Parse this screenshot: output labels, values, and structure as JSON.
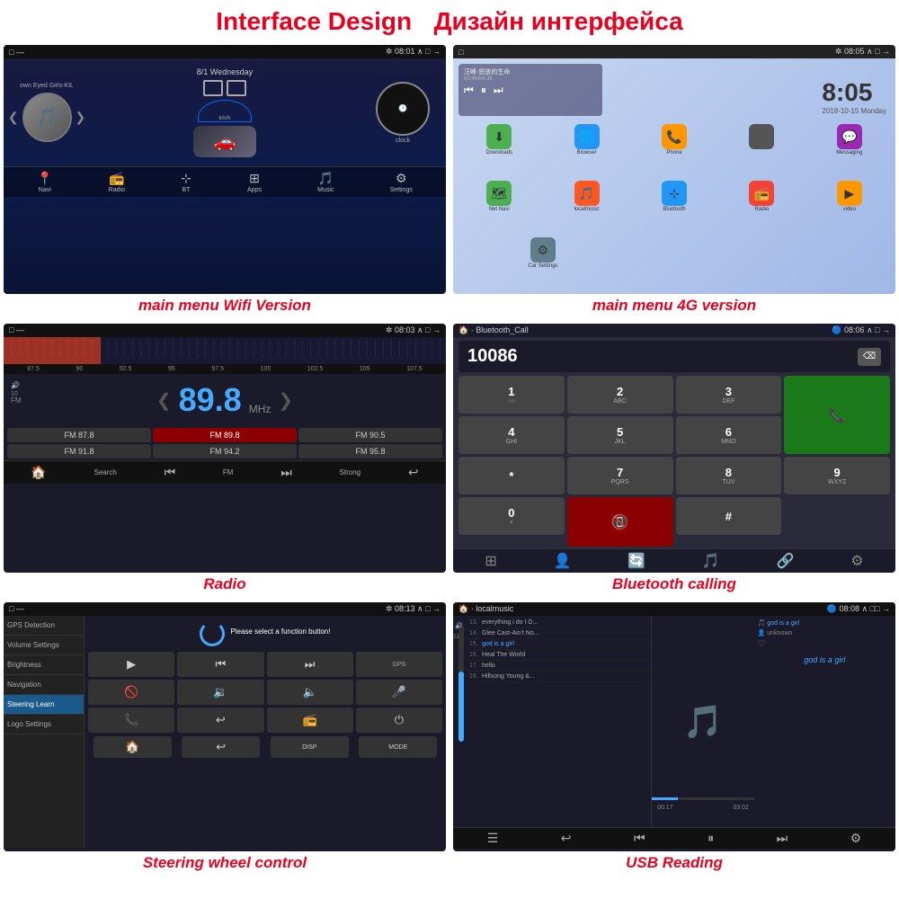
{
  "header": {
    "title_en": "Interface Design",
    "title_ru": "Дизайн интерфейса"
  },
  "captions": {
    "wifi": "main menu Wifi Version",
    "g4": "main menu 4G version",
    "radio": "Radio",
    "bluetooth": "Bluetooth calling",
    "steering": "Steering wheel control",
    "usb": "USB Reading"
  },
  "screen1": {
    "topbar_time": "08:01",
    "song": "own Eyed Girls-KIL",
    "date": "8/1 Wednesday",
    "kmh": "km/h",
    "clock_label": "clock",
    "nav_items": [
      "Navi",
      "Radio",
      "BT",
      "Apps",
      "Music",
      "Settings"
    ]
  },
  "screen2": {
    "topbar_time": "08:05",
    "player_title": "汪峰·怒放的生命",
    "player_time": "00:46/04:35",
    "time_big": "8:05",
    "date_text": "2018-10-15  Monday",
    "apps": [
      {
        "name": "Downloads",
        "color": "#4caf50"
      },
      {
        "name": "Browser",
        "color": "#2196f3"
      },
      {
        "name": "Phone",
        "color": "#ff9800"
      },
      {
        "name": "",
        "color": "#9e9e9e"
      },
      {
        "name": "Messaging",
        "color": "#9c27b0"
      },
      {
        "name": "Net Navi",
        "color": "#4caf50"
      },
      {
        "name": "localmusic",
        "color": "#ff5722"
      },
      {
        "name": "Bluetooth",
        "color": "#2196f3"
      },
      {
        "name": "Radio",
        "color": "#f44336"
      },
      {
        "name": "video",
        "color": "#ff9800"
      },
      {
        "name": "Car Settings",
        "color": "#607d8b"
      }
    ]
  },
  "screen3": {
    "topbar_time": "08:03",
    "freq_scale": [
      "87.5",
      "90",
      "92.5",
      "95",
      "97.5",
      "100",
      "102.5",
      "105",
      "107.5"
    ],
    "current_freq": "89.8",
    "mhz": "MHz",
    "fm_label": "FM",
    "presets": [
      "FM 87.8",
      "FM 89.8",
      "FM 90.5",
      "FM 91.8",
      "FM 94.2",
      "FM 95.8"
    ],
    "active_preset": "FM 89.8",
    "bottom_items": [
      "🏠",
      "Search",
      "⏮",
      "FM",
      "⏭",
      "Strong",
      "↩"
    ]
  },
  "screen4": {
    "topbar_label": "Bluetooth_Call",
    "topbar_time": "08:06",
    "number": "10086",
    "keys": [
      "1",
      "2 ABC",
      "3 DEF",
      "*",
      "4 GHI",
      "5 JKL",
      "6 MNO",
      "0 +",
      "7 PQRS",
      "8 TUV",
      "9 WXYZ",
      "#"
    ],
    "bottom_icons": [
      "⊞",
      "👤",
      "🔄",
      "🎵",
      "🔗",
      "⚙"
    ]
  },
  "screen5": {
    "topbar_time": "08:13",
    "instruction": "Please select a function button!",
    "sidebar_items": [
      "GPS Detection",
      "Volume Settings",
      "Brightness",
      "Navigation",
      "Steering Learn",
      "Logo Settings"
    ],
    "active_item": "Steering Learn",
    "btn_rows": [
      [
        "▶",
        "⏮",
        "⏭",
        "GPS"
      ],
      [
        "🚫",
        "🔉",
        "🔈",
        "🎤"
      ],
      [
        "📞",
        "↩",
        "📻",
        "⏻"
      ]
    ],
    "bottom_row": [
      "🏠",
      "↩",
      "DISP",
      "MODE"
    ]
  },
  "screen6": {
    "topbar_source": "localmusic",
    "topbar_time": "08:08",
    "tracks": [
      {
        "num": "13.",
        "title": "everything i do I D..."
      },
      {
        "num": "14.",
        "title": "Glee Cast-Ain't No..."
      },
      {
        "num": "15.",
        "title": "god is a girl",
        "active": true
      },
      {
        "num": "16.",
        "title": "Heal The World"
      },
      {
        "num": "17.",
        "title": "hello"
      },
      {
        "num": "18.",
        "title": "Hillsong Young &..."
      }
    ],
    "current_track_num": 21,
    "right_panel": [
      "god is a girl",
      "unknown",
      "❤"
    ],
    "playing_label": "god is a girl",
    "time_current": "00:17",
    "time_total": "03:02",
    "bottom_icons": [
      "☰",
      "↩",
      "⏮",
      "⏸",
      "⏭",
      "⚙"
    ]
  }
}
